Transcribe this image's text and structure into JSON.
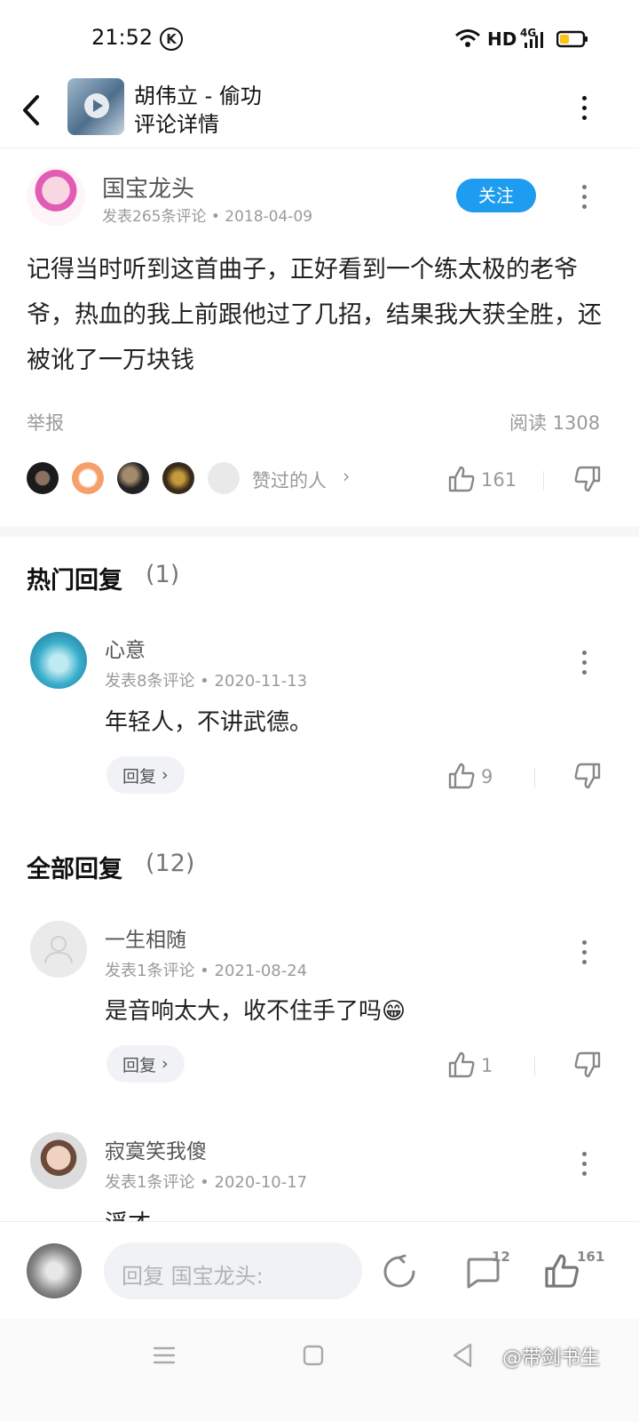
{
  "status_bar": {
    "time": "21:52",
    "network": "HD",
    "signal": "4G"
  },
  "header": {
    "song_title": "胡伟立 - 偷功",
    "subtitle": "评论详情"
  },
  "main_comment": {
    "author": "国宝龙头",
    "meta": "发表265条评论 • 2018-04-09",
    "follow_label": "关注",
    "text": "记得当时听到这首曲子，正好看到一个练太极的老爷爷，热血的我上前跟他过了几招，结果我大获全胜，还被讹了一万块钱",
    "report_label": "举报",
    "read_count": "阅读 1308",
    "likers_label": "赞过的人",
    "like_count": "161"
  },
  "hot_replies": {
    "heading": "热门回复",
    "count": "(1)",
    "items": [
      {
        "author": "心意",
        "meta": "发表8条评论 • 2020-11-13",
        "text": "年轻人，不讲武德。",
        "reply_label": "回复",
        "likes": "9"
      }
    ]
  },
  "all_replies": {
    "heading": "全部回复",
    "count": "(12)",
    "items": [
      {
        "author": "一生相随",
        "meta": "发表1条评论 • 2021-08-24",
        "text": "是音响太大，收不住手了吗😁",
        "reply_label": "回复",
        "likes": "1"
      },
      {
        "author": "寂寞笑我傻",
        "meta": "发表1条评论 • 2020-10-17",
        "text": "浮才"
      }
    ]
  },
  "bottom_bar": {
    "input_placeholder": "回复 国宝龙头:",
    "comment_badge": "12",
    "like_badge": "161"
  },
  "watermark": "@带剑书生",
  "colors": {
    "accent": "#1e9cf0",
    "muted": "#9a9a9a",
    "reply_pill": "#f0f2f6"
  }
}
